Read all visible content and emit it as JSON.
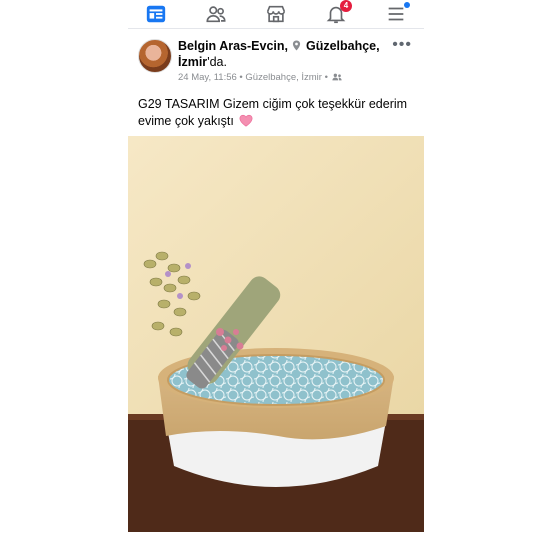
{
  "nav": {
    "items": [
      {
        "name": "home",
        "icon": "feed-icon",
        "active": true
      },
      {
        "name": "friends",
        "icon": "friends-icon"
      },
      {
        "name": "marketplace",
        "icon": "marketplace-icon"
      },
      {
        "name": "notifications",
        "icon": "bell-icon",
        "badge": "4"
      },
      {
        "name": "menu",
        "icon": "hamburger-icon",
        "dot": true
      }
    ],
    "accent": "#1877f2",
    "badge_color": "#e41e3f"
  },
  "post": {
    "author": "Belgin Aras-Evcin,",
    "location": "Güzelbahçe, İzmir",
    "location_suffix": "'da.",
    "timestamp": "24 May, 11:56 • Güzelbahçe, İzmir •",
    "audience_icon": "friends-audience-icon",
    "text": "G29 TASARIM Gizem ciğim çok teşekkür ederim evime çok yakıştı",
    "emoji": "pink-heart"
  }
}
